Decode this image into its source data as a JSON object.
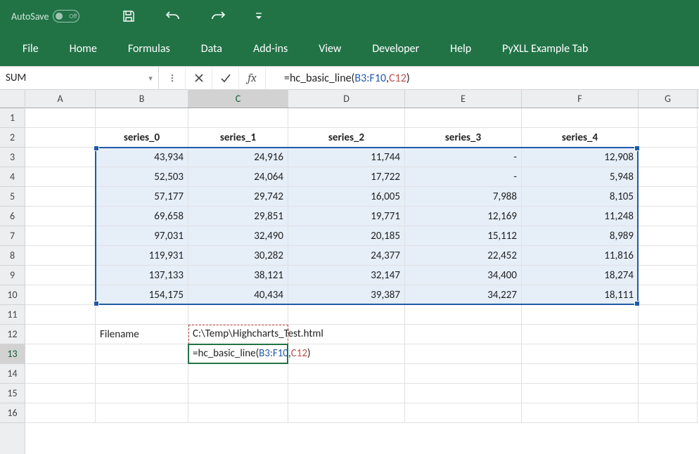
{
  "titleBar": {
    "autoSaveLabel": "AutoSave",
    "toggleOff": "Off"
  },
  "ribbonTabs": [
    "File",
    "Home",
    "Formulas",
    "Data",
    "Add-ins",
    "View",
    "Developer",
    "Help",
    "PyXLL Example Tab"
  ],
  "nameBox": "SUM",
  "fxLabel": "fx",
  "formulaBar": {
    "prefix": "=hc_basic_line(",
    "ref1": "B3:F10",
    "sep": ",",
    "ref2": "C12",
    "suffix": ")"
  },
  "columns": [
    "A",
    "B",
    "C",
    "D",
    "E",
    "F",
    "G"
  ],
  "rows": [
    "1",
    "2",
    "3",
    "4",
    "5",
    "6",
    "7",
    "8",
    "9",
    "10",
    "11",
    "12",
    "13",
    "14",
    "15",
    "16"
  ],
  "headers": [
    "series_0",
    "series_1",
    "series_2",
    "series_3",
    "series_4"
  ],
  "data": [
    [
      "43,934",
      "24,916",
      "11,744",
      "-",
      "12,908"
    ],
    [
      "52,503",
      "24,064",
      "17,722",
      "-",
      "5,948"
    ],
    [
      "57,177",
      "29,742",
      "16,005",
      "7,988",
      "8,105"
    ],
    [
      "69,658",
      "29,851",
      "19,771",
      "12,169",
      "11,248"
    ],
    [
      "97,031",
      "32,490",
      "20,185",
      "15,112",
      "8,989"
    ],
    [
      "119,931",
      "30,282",
      "24,377",
      "22,452",
      "11,816"
    ],
    [
      "137,133",
      "38,121",
      "32,147",
      "34,400",
      "18,274"
    ],
    [
      "154,175",
      "40,434",
      "39,387",
      "34,227",
      "18,111"
    ]
  ],
  "filenameLabel": "Filename",
  "filenameValue": "C:\\Temp\\Highcharts_Test.html",
  "cellFormula": {
    "prefix": "=hc_basic_line(",
    "ref1": "B3:F10",
    "sep": ",",
    "ref2": "C12",
    "suffix": ")"
  },
  "activeColumn": "C",
  "activeRow": "13"
}
